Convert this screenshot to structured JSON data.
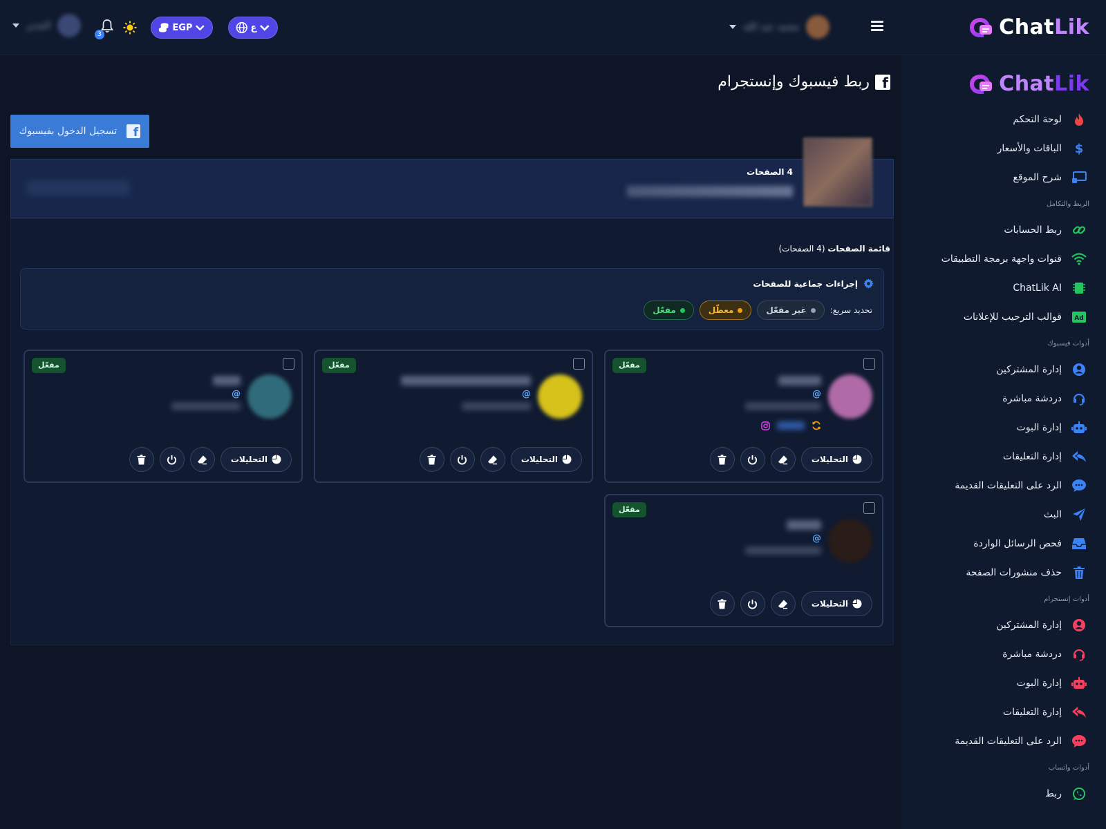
{
  "brand": {
    "name_part1": "Chat",
    "name_part2": "Lik"
  },
  "topbar": {
    "right_user_name": "محمد عبد الله",
    "currency": "EGP",
    "language": "ع",
    "left_user_name": "المدير",
    "notifications_count": "3"
  },
  "sidebar": {
    "main_items": [
      {
        "label": "لوحة التحكم",
        "icon": "fire-icon",
        "color": "#ef4444"
      },
      {
        "label": "الباقات والأسعار",
        "icon": "dollar-icon",
        "color": "#3b82f6"
      },
      {
        "label": "شرح الموقع",
        "icon": "screen-icon",
        "color": "#3b82f6"
      }
    ],
    "sections": [
      {
        "label": "الربط والتكامل",
        "items": [
          {
            "label": "ربط الحسابات",
            "icon": "link-icon",
            "color": "#22c55e"
          },
          {
            "label": "قنوات واجهة برمجة التطبيقات",
            "icon": "wifi-icon",
            "color": "#22c55e"
          },
          {
            "label": "ChatLik AI",
            "icon": "chip-icon",
            "color": "#22c55e"
          },
          {
            "label": "قوالب الترحيب للإعلانات",
            "icon": "ad-icon",
            "color": "#22c55e"
          }
        ]
      },
      {
        "label": "أدوات فيسبوك",
        "items": [
          {
            "label": "إدارة المشتركين",
            "icon": "user-icon",
            "color": "#3b82f6"
          },
          {
            "label": "دردشة مباشرة",
            "icon": "headset-icon",
            "color": "#3b82f6"
          },
          {
            "label": "إدارة البوت",
            "icon": "robot-icon",
            "color": "#3b82f6"
          },
          {
            "label": "إدارة التعليقات",
            "icon": "reply-icon",
            "color": "#3b82f6"
          },
          {
            "label": "الرد على التعليقات القديمة",
            "icon": "comment-icon",
            "color": "#3b82f6"
          },
          {
            "label": "البث",
            "icon": "send-icon",
            "color": "#3b82f6"
          },
          {
            "label": "فحص الرسائل الواردة",
            "icon": "inbox-icon",
            "color": "#3b82f6"
          },
          {
            "label": "حذف منشورات الصفحة",
            "icon": "trash-icon",
            "color": "#3b82f6"
          }
        ]
      },
      {
        "label": "أدوات إنستجرام",
        "items": [
          {
            "label": "إدارة المشتركين",
            "icon": "user-icon",
            "color": "#f43f5e"
          },
          {
            "label": "دردشة مباشرة",
            "icon": "headset-icon",
            "color": "#f43f5e"
          },
          {
            "label": "إدارة البوت",
            "icon": "robot-icon",
            "color": "#f43f5e"
          },
          {
            "label": "إدارة التعليقات",
            "icon": "reply-icon",
            "color": "#f43f5e"
          },
          {
            "label": "الرد على التعليقات القديمة",
            "icon": "comment-icon",
            "color": "#f43f5e"
          }
        ]
      },
      {
        "label": "أدوات واتساب",
        "items": [
          {
            "label": "ربط",
            "icon": "whatsapp-icon",
            "color": "#22c55e"
          }
        ]
      }
    ]
  },
  "main": {
    "title": "ربط فيسبوك وإنستجرام",
    "fb_login_label": "تسجيل الدخول بفيسبوك",
    "pages_count_label": "4 الصفحات",
    "list_title_bold": "قائمة الصفحات",
    "list_title_rest": "(4 الصفحات)",
    "bulk_title": "إجراءات جماعية للصفحات",
    "quick_label": "تحديد سريع:",
    "chips": [
      {
        "label": "غير مفعّل",
        "style": "gray"
      },
      {
        "label": "معطّل",
        "style": "amber"
      },
      {
        "label": "مفعّل",
        "style": "green"
      }
    ],
    "cards": [
      {
        "badge": "مفعّل",
        "at": "@",
        "analytics_label": "التحليلات",
        "avatar_color": "#b06aa8",
        "has_instagram": true
      },
      {
        "badge": "مفعّل",
        "at": "@",
        "analytics_label": "التحليلات",
        "avatar_color": "#d6c21a",
        "has_instagram": false
      },
      {
        "badge": "مفعّل",
        "at": "@",
        "analytics_label": "التحليلات",
        "avatar_color": "#2f6b7a",
        "has_instagram": false
      },
      {
        "badge": "مفعّل",
        "at": "@",
        "analytics_label": "التحليلات",
        "avatar_color": "#2a1c18",
        "has_instagram": false
      }
    ]
  }
}
